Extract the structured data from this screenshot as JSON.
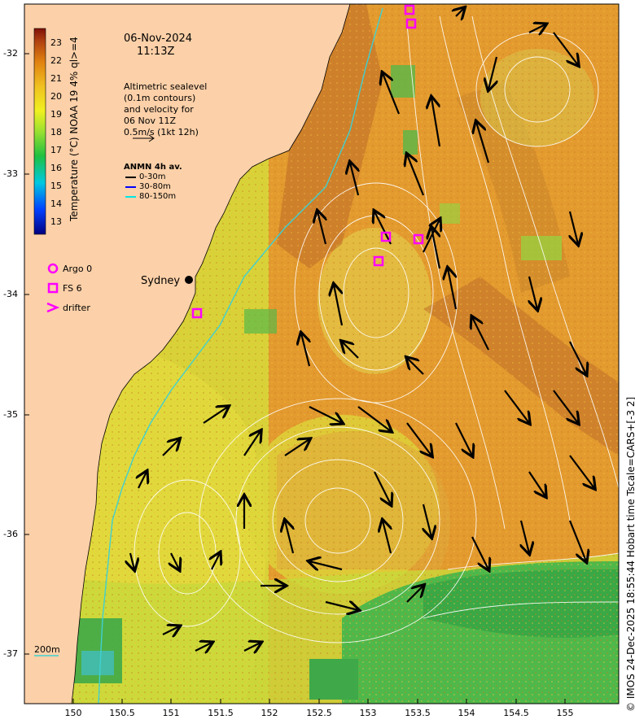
{
  "header": {
    "date": "06-Nov-2024",
    "time": "11:13Z"
  },
  "description": {
    "lines": [
      "Altimetric sealevel",
      "(0.1m contours)",
      "and velocity for",
      "06 Nov 11Z",
      "0.5m/s (1kt 12h)"
    ]
  },
  "anmn": {
    "title": "ANMN 4h av.",
    "rows": [
      {
        "label": "0-30m",
        "color": "#000000"
      },
      {
        "label": "30-80m",
        "color": "#0000ff"
      },
      {
        "label": "80-150m",
        "color": "#00e5e5"
      }
    ]
  },
  "colorbar": {
    "title": "Temperature (°C) NOAA 19 4% ql>=4",
    "ticks": [
      "23",
      "22",
      "21",
      "20",
      "19",
      "18",
      "17",
      "16",
      "15",
      "14",
      "13"
    ]
  },
  "legend": {
    "items": [
      {
        "label": "Argo 0",
        "symbol": "circle"
      },
      {
        "label": "FS 6",
        "symbol": "square"
      },
      {
        "label": "drifter",
        "symbol": "chevron"
      }
    ],
    "marker_color": "#ff00ff"
  },
  "place": {
    "name": "Sydney"
  },
  "depth_label": "200m",
  "axes": {
    "x_ticks": [
      "150",
      "150.5",
      "151",
      "151.5",
      "152",
      "152.5",
      "153",
      "153.5",
      "154",
      "154.5",
      "155"
    ],
    "y_ticks": [
      "-32",
      "-33",
      "-34",
      "-35",
      "-36",
      "-37"
    ]
  },
  "copyright": "© IMOS 24-Dec-2025 18:55:44 Hobart time Tscale=CARS+[-3 2]",
  "colors": {
    "land": "#fcd0a8",
    "sea_warm": "#e89a2a",
    "sea_cool": "#e6e03a",
    "sea_cold": "#4fb84a",
    "contour": "#ffffff",
    "arrow": "#000000"
  }
}
